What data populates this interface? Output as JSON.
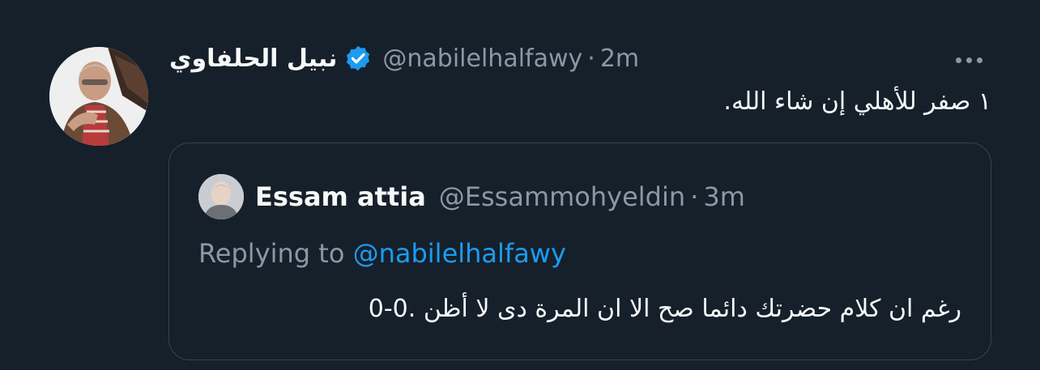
{
  "tweet": {
    "display_name": "نبيل الحلفاوي",
    "handle": "@nabilelhalfawy",
    "separator": "·",
    "time": "2m",
    "text": "١ صفر للأهلي إن شاء الله.",
    "verified": true
  },
  "quoted_tweet": {
    "display_name": "Essam attia",
    "handle": "@Essammohyeldin",
    "separator": "·",
    "time": "3m",
    "replying_label": "Replying to",
    "replying_handle": "@nabilelhalfawy",
    "text": "رغم ان كلام حضرتك دائما صح الا ان المرة دى لا أظن .0-0"
  },
  "colors": {
    "background": "#15202b",
    "text_primary": "#f7f9f9",
    "text_secondary": "#8b98a5",
    "accent": "#1d9bf0",
    "border": "#38444d"
  },
  "icons": {
    "verified": "verified-badge-icon",
    "more": "more-options-icon"
  }
}
